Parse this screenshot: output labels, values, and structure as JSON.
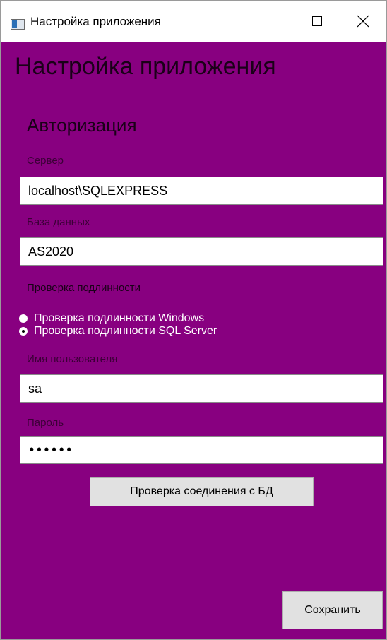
{
  "window": {
    "title": "Настройка приложения"
  },
  "page": {
    "title": "Настройка приложения"
  },
  "auth_section": {
    "title": "Авторизация",
    "server_label": "Сервер",
    "server_value": "localhost\\SQLEXPRESS",
    "database_label": "База данных",
    "database_value": "AS2020",
    "auth_label": "Проверка подлинности",
    "auth_options": [
      {
        "label": "Проверка подлинности Windows",
        "selected": false
      },
      {
        "label": "Проверка подлинности SQL Server",
        "selected": true
      }
    ],
    "username_label": "Имя пользователя",
    "username_value": "sa",
    "password_label": "Пароль",
    "password_value": "••••••"
  },
  "buttons": {
    "test_connection": "Проверка соединения с БД",
    "save": "Сохранить"
  },
  "colors": {
    "background": "#880080",
    "button": "#e1e1e1"
  },
  "icons": {
    "app": "app-window-icon",
    "minimize": "minimize-icon",
    "maximize": "maximize-icon",
    "close": "close-icon"
  }
}
